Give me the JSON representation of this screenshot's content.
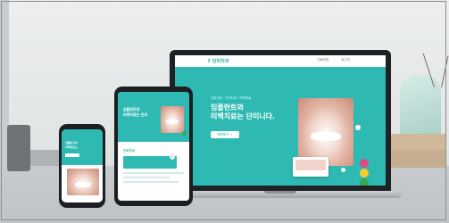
{
  "laptop_site": {
    "logo": "❣ 단미치과",
    "nav_links": [
      "진료마감",
      "로그인"
    ],
    "tagline": "단미치과 · 단미치과 · 미백치료",
    "headline_1": "임플란트와",
    "headline_2": "미백치료는 단미니다.",
    "cta": "예약하기 →"
  },
  "tablet_site": {
    "headline_1": "임플란트와",
    "headline_2": "미백치료는 단미",
    "section_title": "진료안내"
  },
  "phone_site": {
    "headline_1": "임플란트와",
    "headline_2": "미백치료는"
  },
  "colors": {
    "brand_teal": "#2fb9b3",
    "accent_pink": "#e04a8a",
    "accent_yellow": "#f2d02c",
    "accent_green": "#34a853"
  }
}
